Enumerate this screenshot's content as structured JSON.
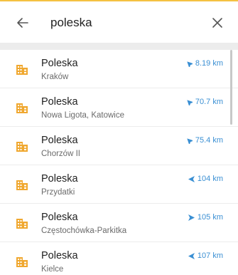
{
  "colors": {
    "accent_top_line": "#f5c242",
    "poi_icon": "#f0a830",
    "distance": "#3a8fd3"
  },
  "search": {
    "back_icon": "arrow-left-icon",
    "value": "poleska",
    "clear_icon": "close-icon"
  },
  "results": [
    {
      "title": "Poleska",
      "subtitle": "Kraków",
      "distance": "8.19 km",
      "direction_deg": 225,
      "icon": "building-icon"
    },
    {
      "title": "Poleska",
      "subtitle": "Nowa Ligota, Katowice",
      "distance": "70.7 km",
      "direction_deg": 225,
      "icon": "building-icon"
    },
    {
      "title": "Poleska",
      "subtitle": "Chorzów II",
      "distance": "75.4 km",
      "direction_deg": 225,
      "icon": "building-icon"
    },
    {
      "title": "Poleska",
      "subtitle": "Przydatki",
      "distance": "104 km",
      "direction_deg": 180,
      "icon": "building-icon"
    },
    {
      "title": "Poleska",
      "subtitle": "Częstochówka-Parkitka",
      "distance": "105 km",
      "direction_deg": 0,
      "icon": "building-icon"
    },
    {
      "title": "Poleska",
      "subtitle": "Kielce",
      "distance": "107 km",
      "direction_deg": 180,
      "icon": "building-icon"
    }
  ]
}
